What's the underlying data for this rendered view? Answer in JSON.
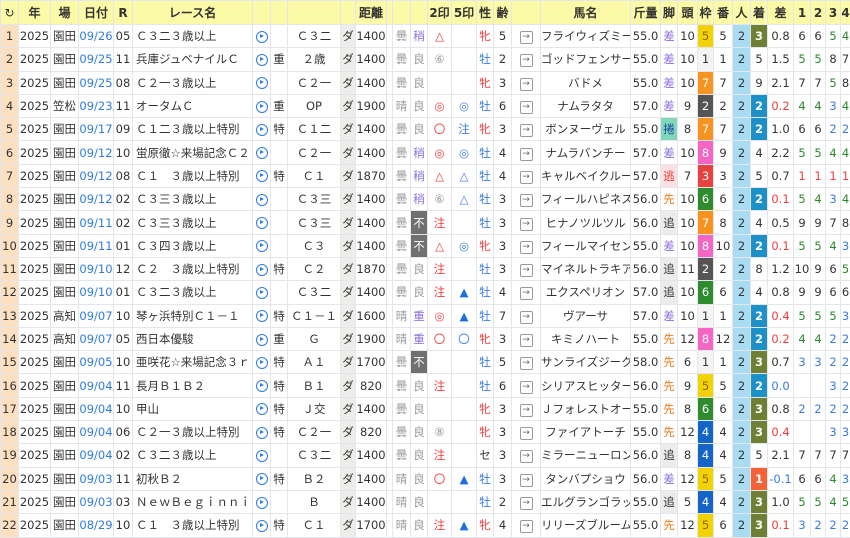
{
  "headers": [
    "↻",
    "年",
    "場",
    "日付",
    "R",
    "レース名",
    "",
    "",
    "",
    "",
    "距離",
    "",
    "",
    "",
    "2印",
    "5印",
    "性",
    "齢",
    "",
    "馬名",
    "斤量",
    "脚",
    "頭",
    "枠",
    "番",
    "人",
    "着",
    "差",
    "1",
    "2",
    "3",
    "4"
  ],
  "colors": {
    "header": "#fbfaa6",
    "row_number": "#fde0c0",
    "popularity": "#a9dcf2",
    "waku": {
      "1": "#f4f4f4",
      "2": "#555555",
      "3": "#e8413f",
      "4": "#1565c8",
      "5": "#f2d200",
      "6": "#2e8b2e",
      "7": "#f7931e",
      "8": "#f566c4"
    },
    "finish": {
      "1": "#f4623a",
      "2": "#1e90c8",
      "3": "#6f7f33"
    }
  },
  "rows": [
    [
      "1",
      "2025",
      "園田",
      "09/26",
      "05",
      "Ｃ３二３歳以上",
      "",
      "Ｃ３二",
      "ダ",
      "1400",
      "曇",
      "稍",
      "△",
      "",
      "牝",
      "5",
      "フライウィズミー",
      "55.0",
      "差",
      "10",
      "5",
      "5",
      "2",
      "3",
      "0.8",
      "6",
      "6",
      "5",
      "4"
    ],
    [
      "2",
      "2025",
      "園田",
      "09/25",
      "11",
      "兵庫ジュベナイルＣ",
      "重",
      "２歳",
      "ダ",
      "1400",
      "曇",
      "良",
      "⑥",
      "",
      "牡",
      "2",
      "ゴッドフェンサー",
      "55.0",
      "差",
      "10",
      "1",
      "1",
      "2",
      "5",
      "1.5",
      "5",
      "5",
      "8",
      "7"
    ],
    [
      "3",
      "2025",
      "園田",
      "09/25",
      "08",
      "Ｃ２一３歳以上",
      "",
      "Ｃ２一",
      "ダ",
      "1400",
      "曇",
      "良",
      "",
      "",
      "牝",
      "3",
      "バドメ",
      "55.0",
      "差",
      "10",
      "7",
      "7",
      "2",
      "9",
      "2.1",
      "7",
      "7",
      "5",
      "8"
    ],
    [
      "4",
      "2025",
      "笠松",
      "09/23",
      "11",
      "オータムＣ",
      "重",
      "OP",
      "ダ",
      "1900",
      "晴",
      "良",
      "◎",
      "◎",
      "牡",
      "6",
      "ナムラタタ",
      "57.0",
      "差",
      "9",
      "2",
      "2",
      "2",
      "2",
      "0.2",
      "4",
      "4",
      "3",
      "4"
    ],
    [
      "5",
      "2025",
      "園田",
      "09/17",
      "09",
      "Ｃ１二３歳以上特別",
      "特",
      "Ｃ１二",
      "ダ",
      "1400",
      "曇",
      "良",
      "〇",
      "注",
      "牝",
      "3",
      "ボンヌーヴェル",
      "55.0",
      "捲",
      "8",
      "7",
      "7",
      "2",
      "2",
      "1.0",
      "6",
      "6",
      "2",
      "2"
    ],
    [
      "6",
      "2025",
      "園田",
      "09/12",
      "10",
      "蛍原徹☆来場記念Ｃ２",
      "",
      "Ｃ２一",
      "ダ",
      "1400",
      "曇",
      "稍",
      "◎",
      "◎",
      "牡",
      "4",
      "ナムラバンチー",
      "57.0",
      "差",
      "10",
      "8",
      "9",
      "2",
      "4",
      "2.2",
      "5",
      "5",
      "4",
      "4"
    ],
    [
      "7",
      "2025",
      "園田",
      "09/12",
      "08",
      "Ｃ１　３歳以上特別",
      "特",
      "Ｃ１",
      "ダ",
      "1870",
      "曇",
      "稍",
      "△",
      "△",
      "牡",
      "4",
      "キャルベイクルーズ",
      "57.0",
      "逃",
      "7",
      "3",
      "3",
      "2",
      "5",
      "0.7",
      "1",
      "1",
      "1",
      "1"
    ],
    [
      "8",
      "2025",
      "園田",
      "09/12",
      "02",
      "Ｃ３三３歳以上",
      "",
      "Ｃ３三",
      "ダ",
      "1400",
      "曇",
      "稍",
      "⑥",
      "△",
      "牡",
      "3",
      "フィールハピネス",
      "56.0",
      "先",
      "10",
      "6",
      "6",
      "2",
      "2",
      "0.1",
      "5",
      "4",
      "3",
      "4"
    ],
    [
      "9",
      "2025",
      "園田",
      "09/11",
      "02",
      "Ｃ３三３歳以上",
      "",
      "Ｃ３三",
      "ダ",
      "1400",
      "曇",
      "不",
      "注",
      "",
      "牡",
      "3",
      "ヒナノツルツル",
      "56.0",
      "追",
      "10",
      "7",
      "8",
      "2",
      "4",
      "0.5",
      "9",
      "9",
      "7",
      "8"
    ],
    [
      "10",
      "2025",
      "園田",
      "09/11",
      "01",
      "Ｃ３四３歳以上",
      "",
      "Ｃ３",
      "ダ",
      "1400",
      "曇",
      "不",
      "△",
      "◎",
      "牝",
      "3",
      "フィールマイセンス",
      "55.0",
      "差",
      "10",
      "8",
      "10",
      "2",
      "2",
      "0.1",
      "5",
      "5",
      "4",
      "3"
    ],
    [
      "11",
      "2025",
      "園田",
      "09/10",
      "12",
      "Ｃ２　３歳以上特別",
      "特",
      "Ｃ２",
      "ダ",
      "1870",
      "曇",
      "良",
      "注",
      "",
      "牡",
      "3",
      "マイネルトラキア",
      "56.0",
      "追",
      "11",
      "2",
      "2",
      "2",
      "8",
      "1.2",
      "10",
      "9",
      "6",
      "5"
    ],
    [
      "12",
      "2025",
      "園田",
      "09/10",
      "01",
      "Ｃ３二３歳以上",
      "",
      "Ｃ３二",
      "ダ",
      "1400",
      "曇",
      "良",
      "注",
      "▲",
      "牡",
      "4",
      "エクスペリオン",
      "57.0",
      "追",
      "10",
      "6",
      "6",
      "2",
      "4",
      "0.8",
      "9",
      "9",
      "6",
      "6"
    ],
    [
      "13",
      "2025",
      "高知",
      "09/07",
      "10",
      "琴ヶ浜特別Ｃ１－１",
      "特",
      "Ｃ１－１",
      "ダ",
      "1600",
      "晴",
      "重",
      "◎",
      "▲",
      "牡",
      "7",
      "ヴアーサ",
      "57.0",
      "差",
      "10",
      "1",
      "1",
      "2",
      "2",
      "0.4",
      "5",
      "5",
      "5",
      "3"
    ],
    [
      "14",
      "2025",
      "高知",
      "09/07",
      "05",
      "西日本優駿",
      "重",
      "Ｇ",
      "ダ",
      "1900",
      "晴",
      "重",
      "〇",
      "〇",
      "牝",
      "3",
      "キミノハート",
      "55.0",
      "先",
      "12",
      "8",
      "12",
      "2",
      "2",
      "0.2",
      "4",
      "4",
      "2",
      "2"
    ],
    [
      "15",
      "2025",
      "園田",
      "09/05",
      "10",
      "亜咲花☆来場記念３ｒ",
      "特",
      "Ａ１",
      "ダ",
      "1700",
      "曇",
      "不",
      "",
      "",
      "牡",
      "5",
      "サンライズジーク",
      "58.0",
      "先",
      "6",
      "1",
      "1",
      "2",
      "3",
      "0.7",
      "3",
      "3",
      "2",
      "2"
    ],
    [
      "16",
      "2025",
      "園田",
      "09/04",
      "11",
      "長月Ｂ１Ｂ２",
      "特",
      "Ｂ１",
      "ダ",
      "820",
      "曇",
      "良",
      "注",
      "",
      "牡",
      "6",
      "シリアスヒッター",
      "56.0",
      "先",
      "9",
      "5",
      "5",
      "2",
      "2",
      "0.0",
      "",
      "",
      "3",
      "2"
    ],
    [
      "17",
      "2025",
      "園田",
      "09/04",
      "10",
      "甲山",
      "特",
      "Ｊ交",
      "ダ",
      "1400",
      "曇",
      "良",
      "",
      "",
      "牝",
      "3",
      "Ｊフォレストオール",
      "55.0",
      "先",
      "8",
      "6",
      "6",
      "2",
      "3",
      "0.8",
      "2",
      "2",
      "2",
      "2"
    ],
    [
      "18",
      "2025",
      "園田",
      "09/04",
      "06",
      "Ｃ２一３歳以上特別",
      "特",
      "Ｃ２一",
      "ダ",
      "820",
      "曇",
      "良",
      "⑧",
      "",
      "牝",
      "3",
      "ファイアトーチ",
      "55.0",
      "先",
      "12",
      "4",
      "4",
      "2",
      "3",
      "0.4",
      "",
      "",
      "3",
      "3"
    ],
    [
      "19",
      "2025",
      "園田",
      "09/04",
      "02",
      "Ｃ３二３歳以上",
      "",
      "Ｃ３二",
      "ダ",
      "1400",
      "曇",
      "良",
      "注",
      "",
      "セ",
      "3",
      "ミラーニューロン",
      "56.0",
      "追",
      "8",
      "4",
      "4",
      "2",
      "5",
      "2.1",
      "7",
      "7",
      "7",
      "7"
    ],
    [
      "20",
      "2025",
      "園田",
      "09/03",
      "11",
      "初秋Ｂ２",
      "特",
      "Ｂ２",
      "ダ",
      "1400",
      "晴",
      "良",
      "〇",
      "▲",
      "牡",
      "3",
      "タンバプショウ",
      "56.0",
      "差",
      "12",
      "5",
      "5",
      "2",
      "1",
      "-0.1",
      "6",
      "6",
      "4",
      "3"
    ],
    [
      "21",
      "2025",
      "園田",
      "09/03",
      "03",
      "ＮｅｗＢｅｇｉｎｎｉ",
      "",
      "Ｂ",
      "ダ",
      "1400",
      "晴",
      "良",
      "",
      "",
      "牡",
      "2",
      "エルグランゴラッソ",
      "55.0",
      "追",
      "5",
      "4",
      "4",
      "2",
      "3",
      "1.0",
      "5",
      "5",
      "4",
      "5"
    ],
    [
      "22",
      "2025",
      "園田",
      "08/29",
      "10",
      "Ｃ１　３歳以上特別",
      "特",
      "Ｃ１",
      "ダ",
      "1700",
      "晴",
      "良",
      "注",
      "▲",
      "牝",
      "4",
      "リリーズブルーム",
      "55.0",
      "先",
      "12",
      "5",
      "6",
      "2",
      "3",
      "0.1",
      "3",
      "2",
      "2",
      "2"
    ]
  ]
}
